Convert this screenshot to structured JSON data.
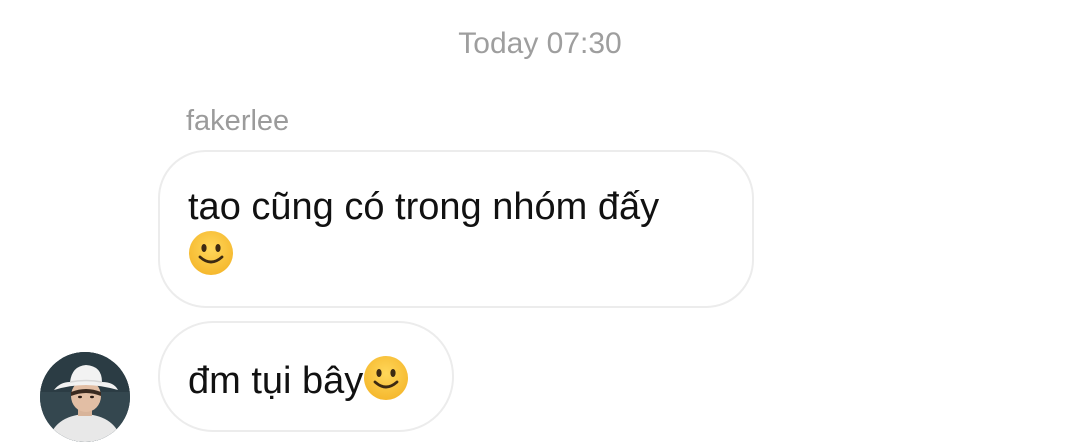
{
  "thread": {
    "timestamp": "Today 07:30"
  },
  "messages": [
    {
      "sender": "fakerlee",
      "text": "tao cũng có trong nhóm đấy",
      "emoji": "slightly-smiling-face-icon"
    },
    {
      "text": "đm tụi bây",
      "emoji": "slightly-smiling-face-icon"
    }
  ],
  "colors": {
    "timestamp": "#9e9e9e",
    "sender": "#9b9b9b",
    "bubble_border": "#ececec",
    "text": "#111111",
    "emoji_face": "#ffc83d"
  }
}
